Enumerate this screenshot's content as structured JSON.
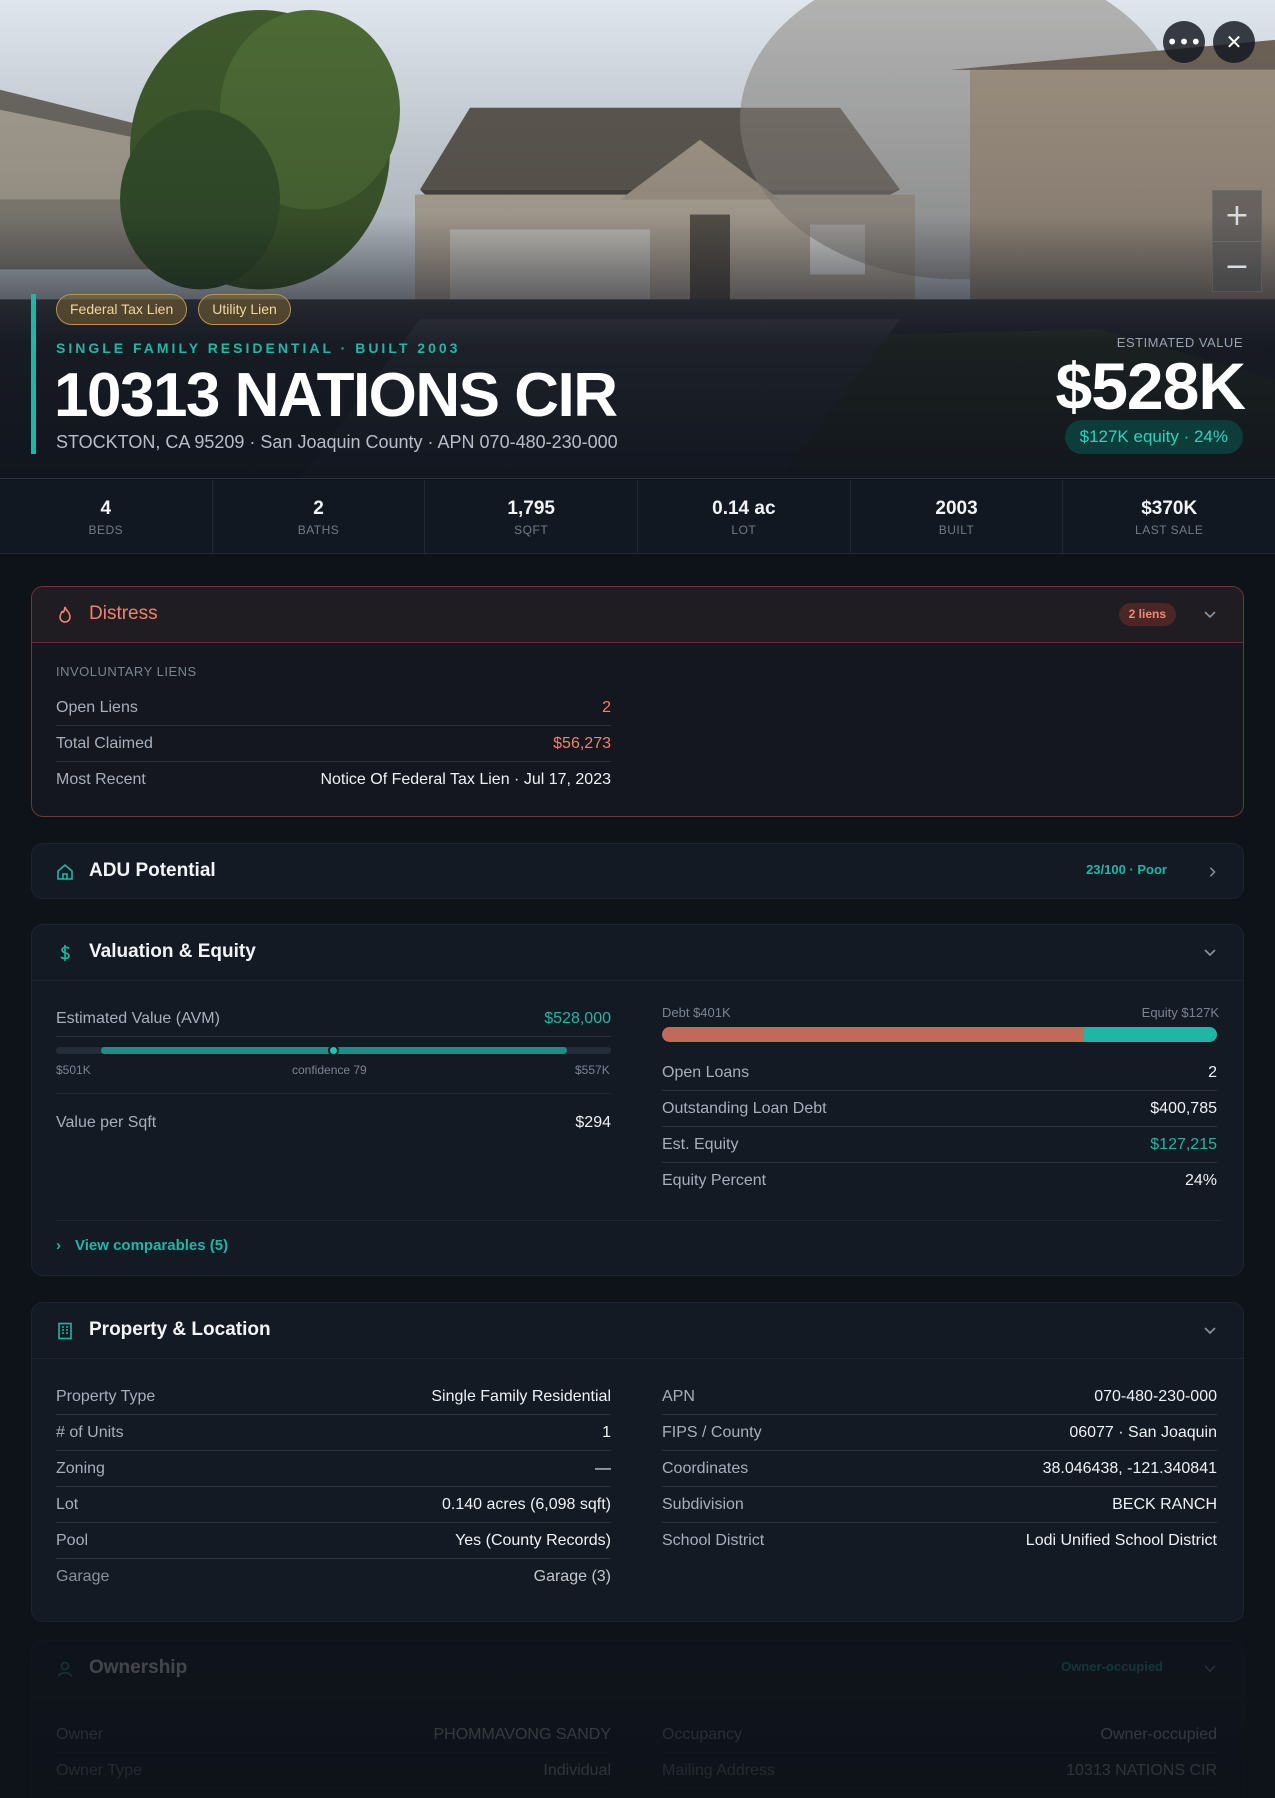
{
  "hero": {
    "badges": [
      "Federal Tax Lien",
      "Utility Lien"
    ],
    "kicker": "SINGLE FAMILY RESIDENTIAL · BUILT 2003",
    "title": "10313 NATIONS CIR",
    "address": "STOCKTON, CA 95209 · San Joaquin County · APN 070-480-230-000",
    "value_label": "ESTIMATED VALUE",
    "value": "$528K",
    "equity_pill": "$127K equity · 24%",
    "more_icon": "more-horizontal-icon",
    "close_icon": "close-icon",
    "zoom_in": "+",
    "zoom_out": "−"
  },
  "stats": [
    {
      "value": "4",
      "label": "BEDS"
    },
    {
      "value": "2",
      "label": "BATHS"
    },
    {
      "value": "1,795",
      "label": "SQFT"
    },
    {
      "value": "0.14 ac",
      "label": "LOT"
    },
    {
      "value": "2003",
      "label": "BUILT"
    },
    {
      "value": "$370K",
      "label": "LAST SALE"
    }
  ],
  "distress": {
    "title": "Distress",
    "pill": "2 liens",
    "section": "INVOLUNTARY LIENS",
    "rows": [
      {
        "k": "Open Liens",
        "v": "2"
      },
      {
        "k": "Total Claimed",
        "v": "$56,273"
      },
      {
        "k": "Most Recent",
        "v": "Notice Of Federal Tax Lien · Jul 17, 2023"
      }
    ]
  },
  "adu": {
    "title": "ADU Potential",
    "score": "23/100 · Poor"
  },
  "valuation": {
    "title": "Valuation & Equity",
    "avm_label": "Estimated Value (AVM)",
    "avm_value": "$528,000",
    "range_low": "$501K",
    "range_conf": "confidence 79",
    "range_high": "$557K",
    "ppsf_label": "Value per Sqft",
    "ppsf_value": "$294",
    "debt_label": "Debt $401K",
    "equity_label": "Equity $127K",
    "debt_fraction": 0.76,
    "rows": [
      {
        "k": "Open Loans",
        "v": "2"
      },
      {
        "k": "Outstanding Loan Debt",
        "v": "$400,785"
      },
      {
        "k": "Est. Equity",
        "v": "$127,215"
      },
      {
        "k": "Equity Percent",
        "v": "24%"
      }
    ],
    "comps_link": "View comparables (5)"
  },
  "property": {
    "title": "Property & Location",
    "left": [
      {
        "k": "Property Type",
        "v": "Single Family Residential"
      },
      {
        "k": "# of Units",
        "v": "1"
      },
      {
        "k": "Zoning",
        "v": "—"
      },
      {
        "k": "Lot",
        "v": "0.140 acres (6,098 sqft)"
      },
      {
        "k": "Pool",
        "v": "Yes (County Records)"
      },
      {
        "k": "Garage",
        "v": "Garage (3)"
      }
    ],
    "right": [
      {
        "k": "APN",
        "v": "070-480-230-000"
      },
      {
        "k": "FIPS / County",
        "v": "06077 · San Joaquin"
      },
      {
        "k": "Coordinates",
        "v": "38.046438, -121.340841"
      },
      {
        "k": "Subdivision",
        "v": "BECK RANCH"
      },
      {
        "k": "School District",
        "v": "Lodi Unified School District"
      }
    ]
  },
  "ownership": {
    "title": "Ownership",
    "pill": "Owner-occupied",
    "left": [
      {
        "k": "Owner",
        "v": "PHOMMAVONG SANDY"
      },
      {
        "k": "Owner Type",
        "v": "Individual"
      }
    ],
    "right": [
      {
        "k": "Occupancy",
        "v": "Owner-occupied"
      },
      {
        "k": "Mailing Address",
        "v": "10313 NATIONS CIR"
      }
    ]
  },
  "colors": {
    "accent": "#1fb7a4",
    "danger": "#f0826f",
    "background": "#0e1219"
  }
}
